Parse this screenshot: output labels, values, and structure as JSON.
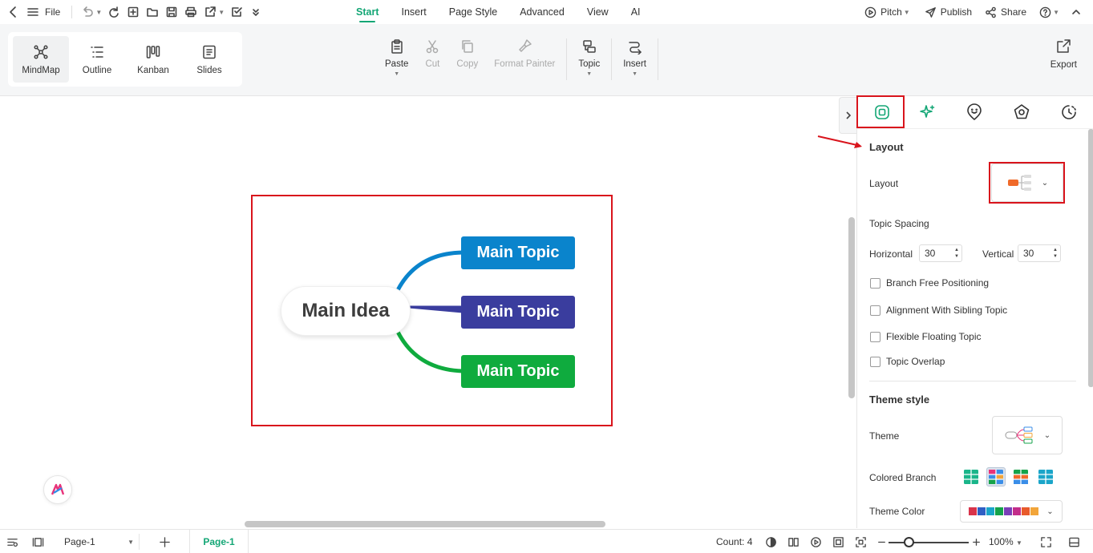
{
  "menu": {
    "file_label": "File",
    "tabs": [
      {
        "label": "Start",
        "active": true
      },
      {
        "label": "Insert",
        "active": false
      },
      {
        "label": "Page Style",
        "active": false
      },
      {
        "label": "Advanced",
        "active": false
      },
      {
        "label": "View",
        "active": false
      },
      {
        "label": "AI",
        "active": false
      }
    ],
    "pitch_label": "Pitch",
    "publish_label": "Publish",
    "share_label": "Share"
  },
  "ribbon": {
    "views": [
      {
        "label": "MindMap",
        "icon": "mindmap-icon",
        "active": true
      },
      {
        "label": "Outline",
        "icon": "outline-icon",
        "active": false
      },
      {
        "label": "Kanban",
        "icon": "kanban-icon",
        "active": false
      },
      {
        "label": "Slides",
        "icon": "slides-icon",
        "active": false
      }
    ],
    "paste": "Paste",
    "cut": "Cut",
    "copy": "Copy",
    "format_painter": "Format Painter",
    "topic": "Topic",
    "insert": "Insert",
    "export": "Export"
  },
  "mindmap": {
    "main_idea": "Main Idea",
    "topics": [
      {
        "label": "Main Topic",
        "color": "#0a84cc"
      },
      {
        "label": "Main Topic",
        "color": "#3a3d9e"
      },
      {
        "label": "Main Topic",
        "color": "#0fab3e"
      }
    ]
  },
  "panel": {
    "tabs": [
      "layout-icon",
      "ai-sparkle-icon",
      "mark-icon",
      "theme-icon",
      "history-icon"
    ],
    "layout_section_title": "Layout",
    "layout_label": "Layout",
    "topic_spacing_label": "Topic Spacing",
    "horizontal_label": "Horizontal",
    "horizontal_value": "30",
    "vertical_label": "Vertical",
    "vertical_value": "30",
    "checkboxes": [
      {
        "label": "Branch Free Positioning",
        "checked": false
      },
      {
        "label": "Alignment With Sibling Topic",
        "checked": false
      },
      {
        "label": "Flexible Floating Topic",
        "checked": false
      },
      {
        "label": "Topic Overlap",
        "checked": false
      }
    ],
    "theme_section_title": "Theme style",
    "theme_label": "Theme",
    "colored_branch_label": "Colored Branch",
    "theme_color_label": "Theme Color",
    "theme_colors": [
      "#d9334a",
      "#2f5fc4",
      "#1aa5c9",
      "#15a34a",
      "#7a3fb8",
      "#c22d8a",
      "#e85a2b",
      "#f2a53a"
    ]
  },
  "statusbar": {
    "page_select": "Page-1",
    "page_tab": "Page-1",
    "count": "Count: 4",
    "zoom": "100%"
  },
  "accent_color": "#13a675",
  "highlight_color": "#d9141c"
}
